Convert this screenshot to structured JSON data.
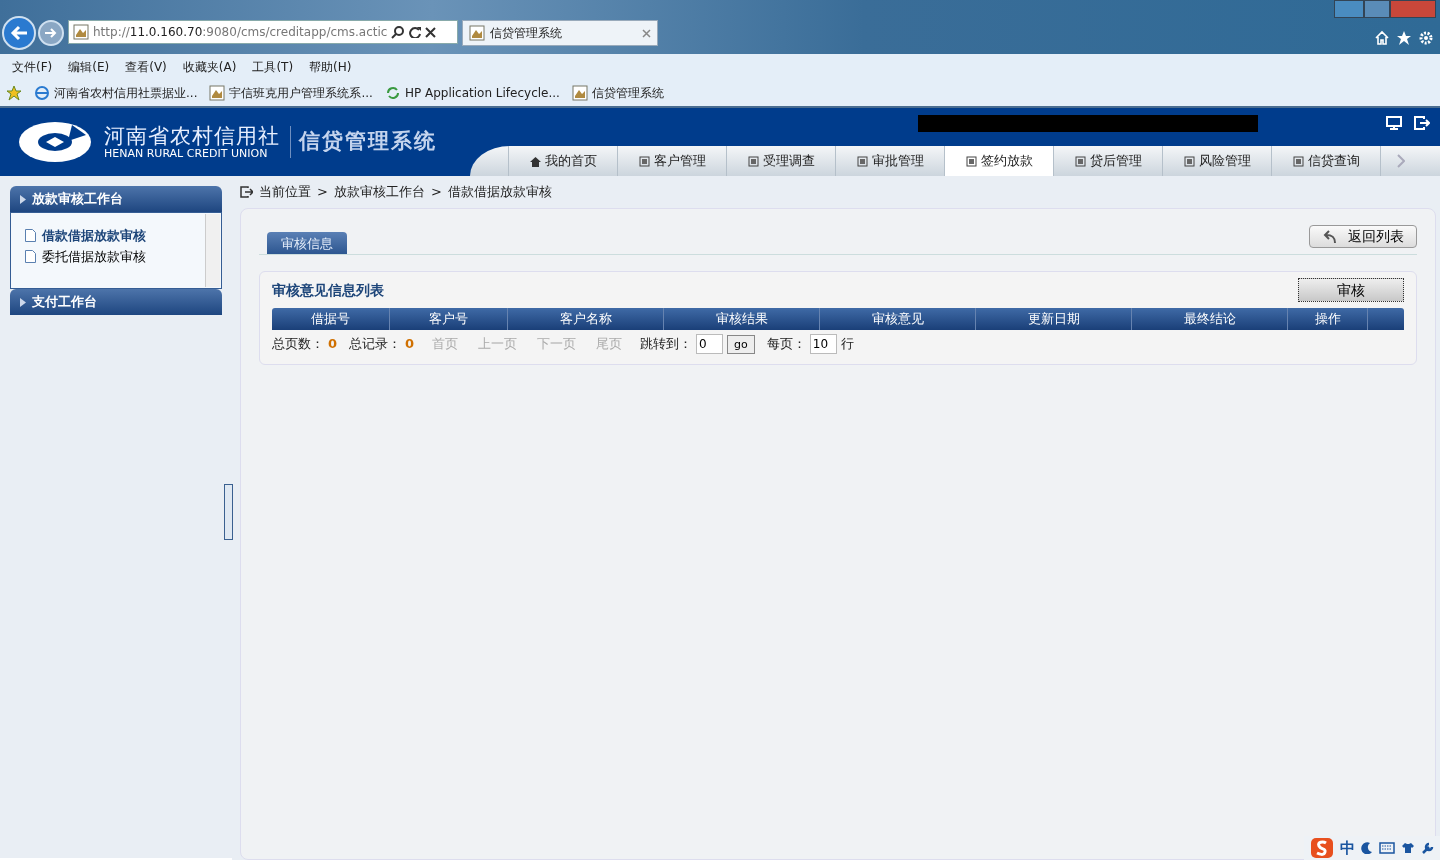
{
  "browser": {
    "address": "http://**11.0.160.70**:9080/cms/creditapp/cms.actic",
    "tab_title": "信贷管理系统",
    "menu": [
      "文件(F)",
      "编辑(E)",
      "查看(V)",
      "收藏夹(A)",
      "工具(T)",
      "帮助(H)"
    ],
    "favorites": [
      {
        "label": "河南省农村信用社票据业...",
        "kind": "ie"
      },
      {
        "label": "宇信班克用户管理系统系...",
        "kind": "page"
      },
      {
        "label": "HP Application Lifecycle...",
        "kind": "hp"
      },
      {
        "label": "信贷管理系统",
        "kind": "page"
      }
    ]
  },
  "header": {
    "logo_cn": "河南省农村信用社",
    "logo_en": "HENAN RURAL CREDIT UNION",
    "system_name": "信贷管理系统",
    "nav": [
      {
        "label": "我的首页",
        "selected": false
      },
      {
        "label": "客户管理",
        "selected": false
      },
      {
        "label": "受理调查",
        "selected": false
      },
      {
        "label": "审批管理",
        "selected": false
      },
      {
        "label": "签约放款",
        "selected": true
      },
      {
        "label": "贷后管理",
        "selected": false
      },
      {
        "label": "风险管理",
        "selected": false
      },
      {
        "label": "信贷查询",
        "selected": false
      }
    ]
  },
  "sidebar": {
    "sections": [
      {
        "title": "放款审核工作台",
        "expanded": true,
        "items": [
          {
            "label": "借款借据放款审核",
            "selected": true
          },
          {
            "label": "委托借据放款审核",
            "selected": false
          }
        ]
      },
      {
        "title": "支付工作台",
        "expanded": false
      }
    ]
  },
  "breadcrumb": {
    "label": "当前位置",
    "items": [
      {
        "separator": ">",
        "label": "放款审核工作台"
      },
      {
        "separator": ">",
        "label": "借款借据放款审核"
      }
    ]
  },
  "tabs": [
    {
      "label": "审核信息",
      "selected": true
    }
  ],
  "back_button": "返回列表",
  "panel": {
    "title": "审核意见信息列表",
    "audit_button": "审核",
    "table": {
      "columns": [
        "借据号",
        "客户号",
        "客户名称",
        "审核结果",
        "审核意见",
        "更新日期",
        "最终结论",
        "操作"
      ]
    },
    "pager": {
      "total_pages_label": "总页数：",
      "total_pages": "0",
      "total_records_label": "总记录：",
      "total_records": "0",
      "links": [
        {
          "label": "首页",
          "disabled": true
        },
        {
          "label": "上一页",
          "disabled": true
        },
        {
          "label": "下一页",
          "disabled": true
        },
        {
          "label": "尾页",
          "disabled": true
        }
      ],
      "jump_label": "跳转到：",
      "jump_value": "0",
      "go": "go",
      "per_page_label": "每页：",
      "per_page": "10",
      "rows_label": "行"
    }
  },
  "ime": {
    "label": "中"
  }
}
